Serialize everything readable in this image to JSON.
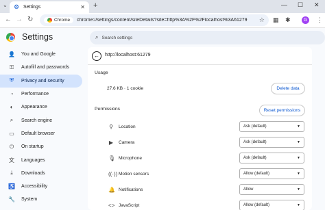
{
  "browser": {
    "tab_title": "Settings",
    "new_tab": "+",
    "tab_list": "⌄",
    "tab_close": "✕",
    "window": {
      "min": "—",
      "max": "☐",
      "close": "✕"
    },
    "nav": {
      "back": "←",
      "forward": "→",
      "reload": "↻"
    },
    "chip_label": "Chrome",
    "url": "chrome://settings/content/siteDetails?site=http%3A%2F%2Flocalhost%3A61279",
    "star": "☆",
    "profile_initial": "G"
  },
  "settings": {
    "title": "Settings",
    "search_placeholder": "Search settings"
  },
  "sidebar": {
    "items": [
      {
        "label": "You and Google",
        "icon": "person-icon",
        "glyph": "👤"
      },
      {
        "label": "Autofill and passwords",
        "icon": "key-icon",
        "glyph": "⚿"
      },
      {
        "label": "Privacy and security",
        "icon": "shield-icon",
        "glyph": "⛨",
        "active": true
      },
      {
        "label": "Performance",
        "icon": "gauge-icon",
        "glyph": "◔"
      },
      {
        "label": "Appearance",
        "icon": "palette-icon",
        "glyph": "◐"
      },
      {
        "label": "Search engine",
        "icon": "search-icon",
        "glyph": "⌕"
      },
      {
        "label": "Default browser",
        "icon": "browser-icon",
        "glyph": "▭"
      },
      {
        "label": "On startup",
        "icon": "power-icon",
        "glyph": "⏻"
      },
      {
        "label": "Languages",
        "icon": "translate-icon",
        "glyph": "文"
      },
      {
        "label": "Downloads",
        "icon": "download-icon",
        "glyph": "⤓"
      },
      {
        "label": "Accessibility",
        "icon": "accessibility-icon",
        "glyph": "♿"
      },
      {
        "label": "System",
        "icon": "wrench-icon",
        "glyph": "🔧"
      }
    ]
  },
  "site_details": {
    "site": "http://localhost:61279",
    "usage_heading": "Usage",
    "usage_text": "27.6 KB · 1 cookie",
    "delete_label": "Delete data",
    "permissions_heading": "Permissions",
    "reset_label": "Reset permissions",
    "permissions": [
      {
        "label": "Location",
        "value": "Ask (default)",
        "icon": "location-icon",
        "glyph": "⚲"
      },
      {
        "label": "Camera",
        "value": "Ask (default)",
        "icon": "camera-icon",
        "glyph": "▶"
      },
      {
        "label": "Microphone",
        "value": "Ask (default)",
        "icon": "microphone-icon",
        "glyph": "🎙"
      },
      {
        "label": "Motion sensors",
        "value": "Allow (default)",
        "icon": "motion-sensor-icon",
        "glyph": "((·))"
      },
      {
        "label": "Notifications",
        "value": "Allow",
        "icon": "bell-icon",
        "glyph": "🔔"
      },
      {
        "label": "JavaScript",
        "value": "Allow (default)",
        "icon": "code-icon",
        "glyph": "<>"
      }
    ]
  }
}
